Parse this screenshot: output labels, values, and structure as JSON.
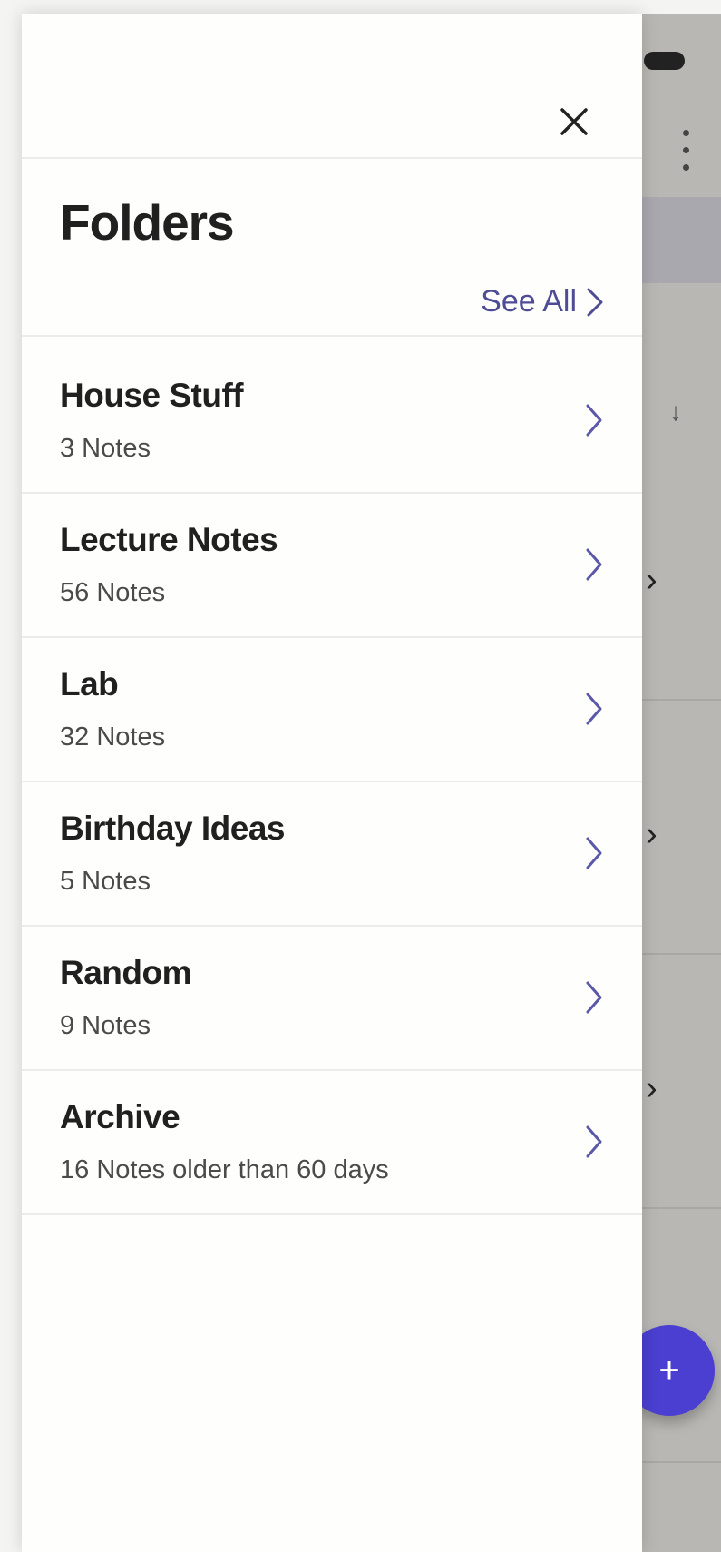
{
  "header": {
    "title": "Folders",
    "see_all_label": "See All"
  },
  "folders": [
    {
      "name": "House Stuff",
      "count": "3 Notes"
    },
    {
      "name": "Lecture Notes",
      "count": "56 Notes"
    },
    {
      "name": "Lab",
      "count": "32 Notes"
    },
    {
      "name": "Birthday Ideas",
      "count": "5 Notes"
    },
    {
      "name": "Random",
      "count": "9 Notes"
    },
    {
      "name": "Archive",
      "count": "16 Notes older than 60 days"
    }
  ],
  "colors": {
    "accent": "#4f4c96",
    "fab": "#4a3fd0",
    "overlay": "#b8b7b3",
    "drawer_bg": "#fefefc"
  },
  "icons": {
    "close": "close-icon",
    "chevron": "chevron-right-icon",
    "menu": "more-vert-icon",
    "add": "plus-icon",
    "sort": "arrow-down-icon"
  }
}
